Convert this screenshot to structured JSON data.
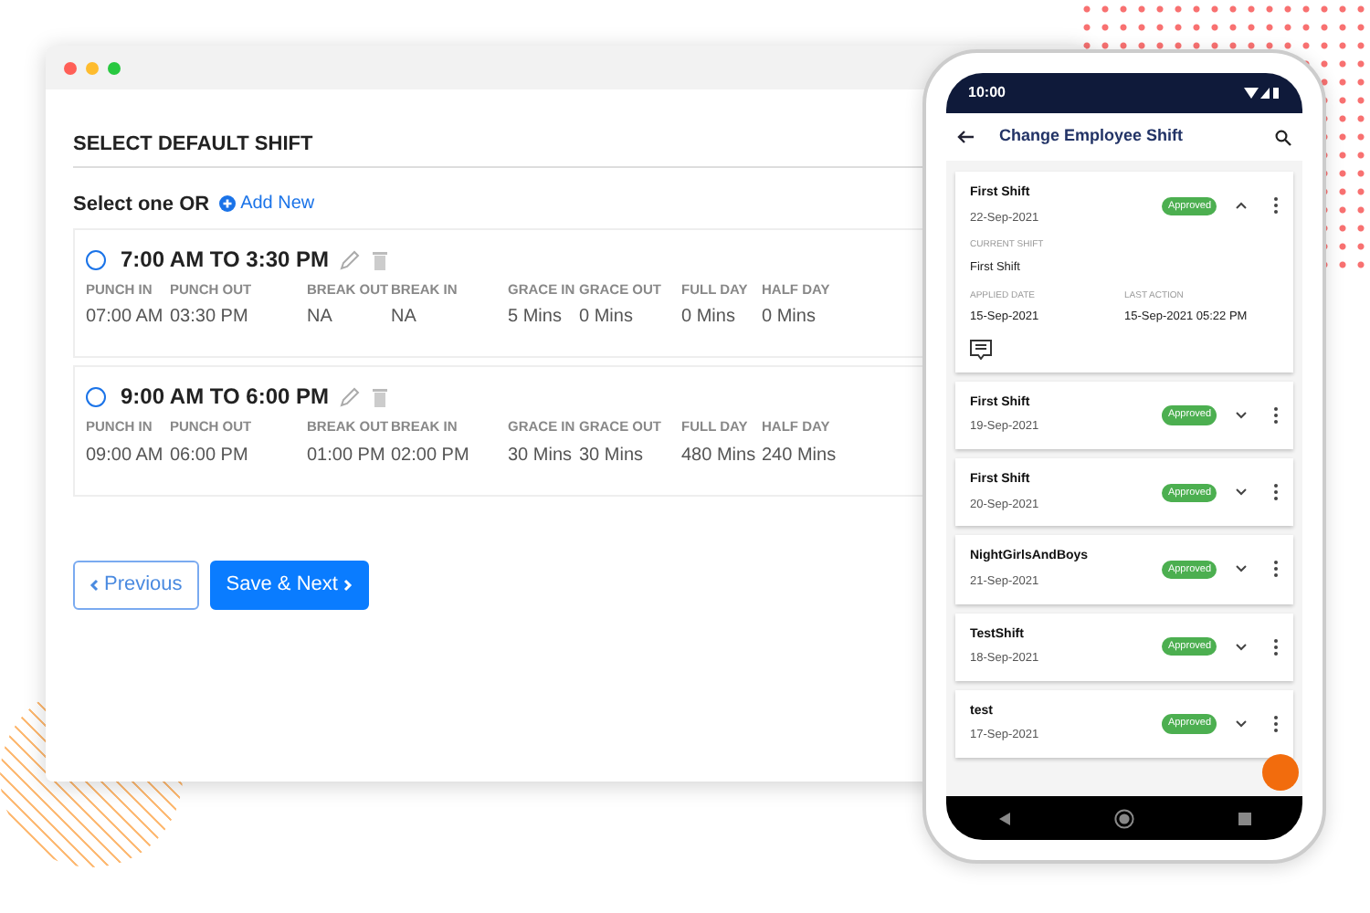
{
  "web": {
    "section_title": "SELECT DEFAULT SHIFT",
    "prompt": "Select one OR",
    "add_new": "Add New",
    "shifts": [
      {
        "title": "7:00 AM TO 3:30 PM",
        "selected": false,
        "fields": [
          {
            "label": "PUNCH IN",
            "value": "07:00 AM"
          },
          {
            "label": "PUNCH OUT",
            "value": "03:30 PM"
          },
          {
            "label": "BREAK OUT",
            "value": "NA"
          },
          {
            "label": "BREAK IN",
            "value": "NA"
          },
          {
            "label": "GRACE IN",
            "value": "5 Mins"
          },
          {
            "label": "GRACE OUT",
            "value": "0 Mins"
          },
          {
            "label": "FULL DAY",
            "value": "0 Mins"
          },
          {
            "label": "HALF DAY",
            "value": "0 Mins"
          }
        ]
      },
      {
        "title": "9:00 AM TO 6:00 PM",
        "selected": false,
        "fields": [
          {
            "label": "PUNCH IN",
            "value": "09:00 AM"
          },
          {
            "label": "PUNCH OUT",
            "value": "06:00 PM"
          },
          {
            "label": "BREAK OUT",
            "value": "01:00 PM"
          },
          {
            "label": "BREAK IN",
            "value": "02:00 PM"
          },
          {
            "label": "GRACE IN",
            "value": "30 Mins"
          },
          {
            "label": "GRACE OUT",
            "value": "30 Mins"
          },
          {
            "label": "FULL DAY",
            "value": "480 Mins"
          },
          {
            "label": "HALF DAY",
            "value": "240 Mins"
          }
        ]
      }
    ],
    "buttons": [
      {
        "label": "Previous",
        "kind": "secondary"
      },
      {
        "label": "Save & Next",
        "kind": "primary"
      }
    ]
  },
  "phone": {
    "time": "10:00",
    "title": "Change Employee Shift",
    "requests": [
      {
        "title": "First Shift",
        "date": "22-Sep-2021",
        "status": "Approved",
        "expanded": true,
        "details": [
          {
            "label": "CURRENT SHIFT",
            "value": "First Shift"
          },
          {
            "label": "APPLIED DATE",
            "value": "15-Sep-2021"
          },
          {
            "label": "LAST ACTION",
            "value": "15-Sep-2021 05:22 PM"
          }
        ]
      },
      {
        "title": "First Shift",
        "date": "19-Sep-2021",
        "status": "Approved",
        "expanded": false
      },
      {
        "title": "First Shift",
        "date": "20-Sep-2021",
        "status": "Approved",
        "expanded": false
      },
      {
        "title": "NightGirlsAndBoys",
        "date": "21-Sep-2021",
        "status": "Approved",
        "expanded": false
      },
      {
        "title": "TestShift",
        "date": "18-Sep-2021",
        "status": "Approved",
        "expanded": false
      },
      {
        "title": "test",
        "date": "17-Sep-2021",
        "status": "Approved",
        "expanded": false
      }
    ]
  }
}
